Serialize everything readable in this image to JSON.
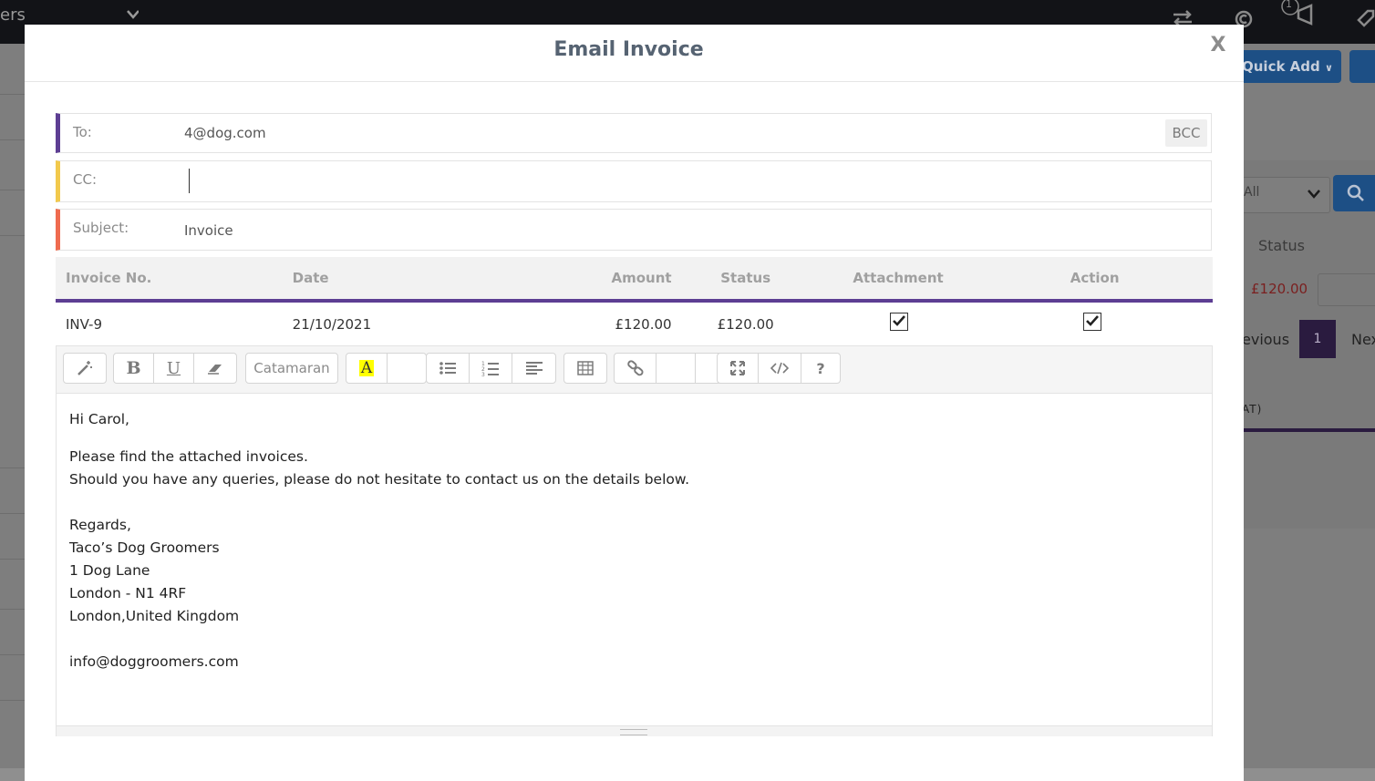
{
  "background": {
    "top_title_fragment": "ers",
    "quick_add_label": "Quick Add",
    "filter_value": "All",
    "status_header": "Status",
    "row_amount": "£120.00",
    "pagination_prev": "evious",
    "pagination_current": "1",
    "pagination_next": "Nex",
    "vat_fragment": "AT)",
    "notification_count": "1"
  },
  "modal": {
    "title": "Email Invoice",
    "close_label": "X"
  },
  "fields": {
    "to_label": "To:",
    "to_value": "4@dog.com",
    "bcc_label": "BCC",
    "cc_label": "CC:",
    "cc_value": "",
    "subject_label": "Subject:",
    "subject_value": "Invoice"
  },
  "table": {
    "headers": [
      "Invoice No.",
      "Date",
      "Amount",
      "Status",
      "Attachment",
      "Action"
    ],
    "rows": [
      {
        "invoice_no": "INV-9",
        "date": "21/10/2021",
        "amount": "£120.00",
        "status": "£120.00",
        "attachment": true,
        "action": true
      }
    ]
  },
  "toolbar": {
    "font_name": "Catamaran",
    "buttons": [
      "magic-icon",
      "bold-icon",
      "underline-icon",
      "eraser-icon",
      "font-family",
      "highlight-color-icon",
      "color-dropdown",
      "unordered-list-icon",
      "ordered-list-icon",
      "align-icon",
      "table-icon",
      "link-icon",
      "picture-button",
      "video-button",
      "fullscreen-icon",
      "code-view-icon",
      "help-icon"
    ]
  },
  "email_body": {
    "greeting": "Hi Carol,",
    "line1": "Please find the attached invoices.",
    "line2": "Should you have any queries, please do not hesitate to contact us on the details below.",
    "regards": "Regards,",
    "company": "Taco’s Dog Groomers",
    "address1": "1 Dog Lane",
    "address2": "London - N1 4RF",
    "address3": "London,United Kingdom",
    "email": "info@doggroomers.com"
  },
  "colors": {
    "accent_purple": "#5d3e93",
    "cc_yellow": "#f2c94c",
    "subject_orange": "#ef6b4f",
    "status_red": "#e02020"
  }
}
